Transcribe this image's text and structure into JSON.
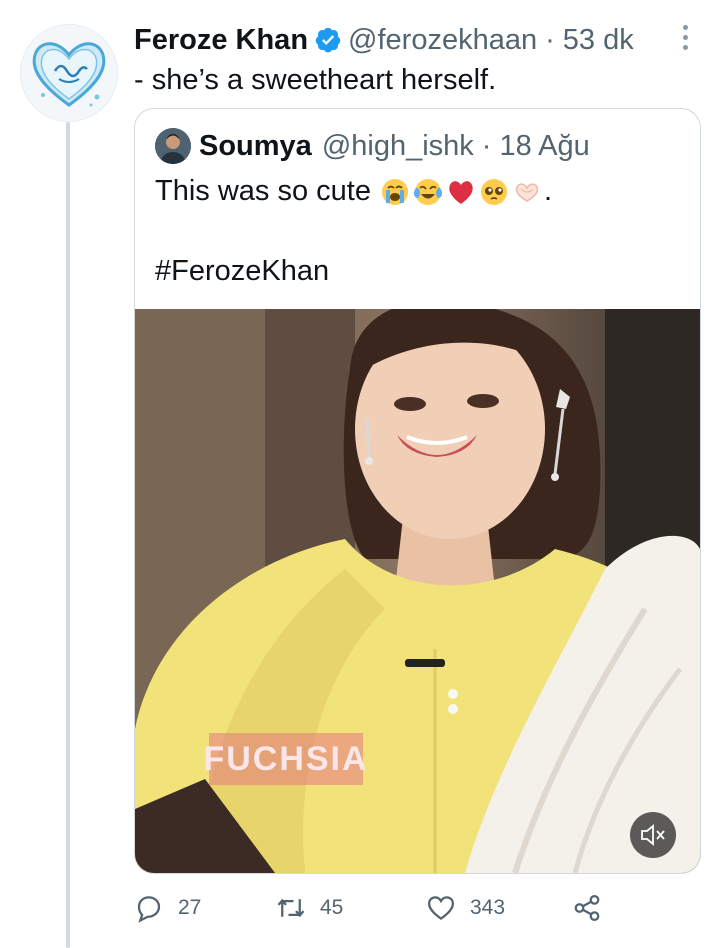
{
  "tweet": {
    "author_name": "Feroze Khan",
    "author_handle": "@ferozekhaan",
    "separator": "·",
    "time": "53 dk",
    "text": "- she’s a sweetheart herself."
  },
  "quoted_tweet": {
    "author_name": "Soumya",
    "author_handle": "@high_ishk",
    "separator": "·",
    "time": "18 Ağu",
    "text": "This was so cute",
    "text_end": ".",
    "emojis": [
      "loudly-crying-face",
      "face-with-tears-of-joy",
      "red-heart",
      "pleading-face",
      "heart-hands"
    ],
    "hashtag": "#FerozeKhan",
    "media": {
      "type": "video",
      "watermark": "FUCHSIA",
      "muted": true
    }
  },
  "actions": {
    "reply_count": "27",
    "retweet_count": "45",
    "like_count": "343"
  },
  "colors": {
    "text": "#0f1419",
    "secondary": "#536471",
    "verified": "#1d9bf0",
    "border": "#cfd9de"
  }
}
